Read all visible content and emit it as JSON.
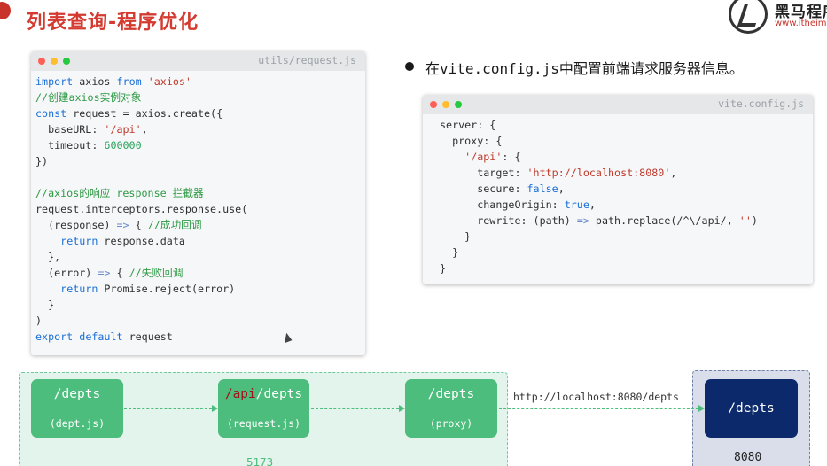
{
  "slide": {
    "title": "列表查询-程序优化",
    "logo": {
      "name": "黑马程序",
      "url": "www.itheim"
    }
  },
  "card1": {
    "filename": "utils/request.js",
    "lines": [
      [
        [
          "kw",
          "import"
        ],
        [
          "p",
          " axios "
        ],
        [
          "kw",
          "from"
        ],
        [
          "p",
          " "
        ],
        [
          "str",
          "'axios'"
        ]
      ],
      [
        [
          "cmt",
          "//创建axios实例对象"
        ]
      ],
      [
        [
          "kw",
          "const"
        ],
        [
          "p",
          " request = axios.create({"
        ]
      ],
      [
        [
          "p",
          "  baseURL: "
        ],
        [
          "str",
          "'/api'"
        ],
        [
          "p",
          ","
        ]
      ],
      [
        [
          "p",
          "  timeout: "
        ],
        [
          "num",
          "600000"
        ]
      ],
      [
        [
          "p",
          "})"
        ]
      ],
      [
        [
          "p",
          ""
        ]
      ],
      [
        [
          "cmt",
          "//axios的响应 response 拦截器"
        ]
      ],
      [
        [
          "p",
          "request.interceptors.response.use("
        ]
      ],
      [
        [
          "p",
          "  (response) "
        ],
        [
          "op",
          "=>"
        ],
        [
          "p",
          " { "
        ],
        [
          "cmt",
          "//成功回调"
        ]
      ],
      [
        [
          "p",
          "    "
        ],
        [
          "kw",
          "return"
        ],
        [
          "p",
          " response.data"
        ]
      ],
      [
        [
          "p",
          "  },"
        ]
      ],
      [
        [
          "p",
          "  (error) "
        ],
        [
          "op",
          "=>"
        ],
        [
          "p",
          " { "
        ],
        [
          "cmt",
          "//失败回调"
        ]
      ],
      [
        [
          "p",
          "    "
        ],
        [
          "kw",
          "return"
        ],
        [
          "p",
          " Promise.reject(error)"
        ]
      ],
      [
        [
          "p",
          "  }"
        ]
      ],
      [
        [
          "p",
          ")"
        ]
      ],
      [
        [
          "kw",
          "export"
        ],
        [
          "p",
          " "
        ],
        [
          "kw",
          "default"
        ],
        [
          "p",
          " request"
        ]
      ]
    ]
  },
  "bullet": {
    "prefix": "在",
    "code": "vite.config.js",
    "suffix": "中配置前端请求服务器信息。"
  },
  "card2": {
    "filename": "vite.config.js",
    "lines": [
      [
        [
          "p",
          "server: {"
        ]
      ],
      [
        [
          "p",
          "  proxy: {"
        ]
      ],
      [
        [
          "p",
          "    "
        ],
        [
          "str",
          "'/api'"
        ],
        [
          "p",
          ": {"
        ]
      ],
      [
        [
          "p",
          "      target: "
        ],
        [
          "str",
          "'http://localhost:8080'"
        ],
        [
          "p",
          ","
        ]
      ],
      [
        [
          "p",
          "      secure: "
        ],
        [
          "kw",
          "false"
        ],
        [
          "p",
          ","
        ]
      ],
      [
        [
          "p",
          "      changeOrigin: "
        ],
        [
          "kw",
          "true"
        ],
        [
          "p",
          ","
        ]
      ],
      [
        [
          "p",
          "      rewrite: (path) "
        ],
        [
          "op",
          "=>"
        ],
        [
          "p",
          " path.replace(/^\\/api/, "
        ],
        [
          "str",
          "''"
        ],
        [
          "p",
          ")"
        ]
      ],
      [
        [
          "p",
          "    }"
        ]
      ],
      [
        [
          "p",
          "  }"
        ]
      ],
      [
        [
          "p",
          "}"
        ]
      ]
    ]
  },
  "diagram": {
    "node1": {
      "main": "/depts",
      "sub": "(dept.js)"
    },
    "node2": {
      "api": "/api",
      "rest": "/depts",
      "sub": "(request.js)"
    },
    "node3": {
      "main": "/depts",
      "sub": "(proxy)"
    },
    "node4": {
      "main": "/depts"
    },
    "proxy_url": "http://localhost:8080/depts",
    "front_port": "5173",
    "server_port": "8080"
  },
  "colors": {
    "title": "#d43a2f",
    "node_green": "#4dbd7d",
    "node_navy": "#0c2a6b",
    "keyword": "#1a6fd6",
    "string": "#c0392b",
    "comment": "#2e9a45"
  }
}
